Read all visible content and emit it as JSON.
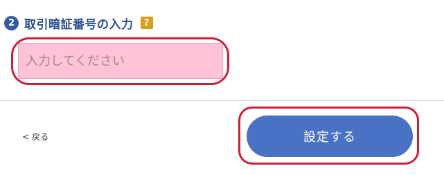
{
  "step": {
    "number": "2",
    "title": "取引暗証番号の入力",
    "help_badge": "?"
  },
  "pin_input": {
    "placeholder": "入力してください",
    "value": ""
  },
  "footer": {
    "back_arrow": "<",
    "back_label": "戻る",
    "submit_label": "設定する"
  },
  "colors": {
    "accent": "#2a4f93",
    "button": "#4a72c4",
    "help_badge": "#d9a01c",
    "input_background": "#ffc2d7",
    "highlight": "#d02030"
  }
}
